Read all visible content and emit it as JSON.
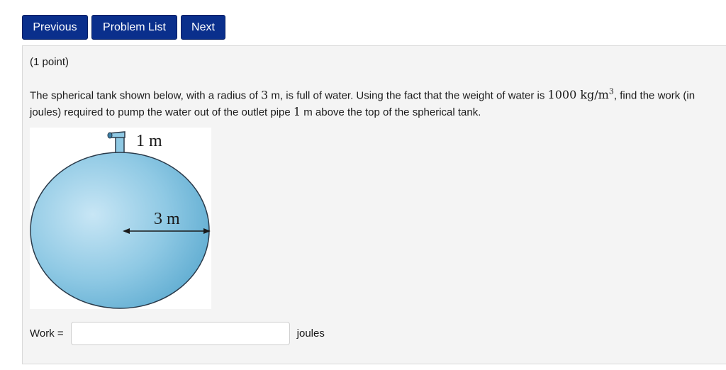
{
  "nav": {
    "previous_label": "Previous",
    "problem_list_label": "Problem List",
    "next_label": "Next"
  },
  "problem": {
    "points": "(1 point)",
    "statement_part1": "The spherical tank shown below, with a radius of ",
    "radius": "3",
    "statement_part2": " m, is full of water. Using the fact that the weight of water is ",
    "weight_value": "1000",
    "weight_units_base": " kg/m",
    "weight_units_exp": "3",
    "statement_part3": ", find the work (in joules) required to pump the water out of the outlet pipe ",
    "pipe_height": "1",
    "statement_part4": " m above the top of the spherical tank.",
    "figure": {
      "pipe_label": "1 m",
      "radius_label": "3 m",
      "tank_color": "#8fc9e4",
      "tank_dark_color": "#5aa9cf"
    },
    "answer": {
      "label": "Work =",
      "value": "",
      "placeholder": "",
      "units": "joules"
    }
  }
}
